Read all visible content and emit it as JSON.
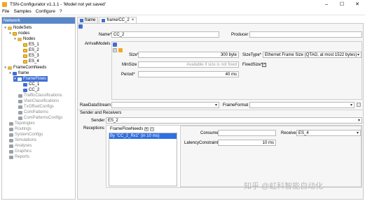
{
  "window": {
    "title": "TSN-Configurator v1.1.1 - 'Model not yet saved'"
  },
  "menu": [
    "File",
    "Samples",
    "Configure",
    "?"
  ],
  "network_panel": {
    "title": "Network",
    "items": [
      {
        "label": "NodeSets",
        "twisty": "▾",
        "icon": "folder"
      },
      {
        "label": "nodes",
        "twisty": "▾",
        "icon": "node"
      },
      {
        "label": "Nodes",
        "twisty": "▾",
        "icon": "folder"
      },
      {
        "label": "ES_1",
        "twisty": "",
        "icon": "node"
      },
      {
        "label": "ES_2",
        "twisty": "",
        "icon": "node"
      },
      {
        "label": "ES_3",
        "twisty": "",
        "icon": "node"
      },
      {
        "label": "ES_4",
        "twisty": "",
        "icon": "node"
      },
      {
        "label": "FrameComNeeds",
        "twisty": "▾",
        "icon": "folder"
      },
      {
        "label": "frame",
        "twisty": "▾",
        "icon": "blue"
      },
      {
        "label": "FrameFlows",
        "twisty": "▾",
        "icon": "blue"
      },
      {
        "label": "CC_1",
        "twisty": "",
        "icon": "blue"
      },
      {
        "label": "CC_2",
        "twisty": "",
        "icon": "blue"
      },
      {
        "label": "TrafficClassifications",
        "twisty": "",
        "icon": "gray"
      },
      {
        "label": "VlanClassifications",
        "twisty": "",
        "icon": "gray"
      },
      {
        "label": "TxOffsetConfigs",
        "twisty": "",
        "icon": "gray"
      },
      {
        "label": "ComPatterns",
        "twisty": "",
        "icon": "gray"
      },
      {
        "label": "ComPatternsConfigs",
        "twisty": "",
        "icon": "gray"
      },
      {
        "label": "Topologies",
        "twisty": "",
        "icon": "gray"
      },
      {
        "label": "Routings",
        "twisty": "",
        "icon": "gray"
      },
      {
        "label": "SystemConfigs",
        "twisty": "",
        "icon": "gray"
      },
      {
        "label": "Simulations",
        "twisty": "",
        "icon": "gray"
      },
      {
        "label": "Analyses",
        "twisty": "",
        "icon": "gray"
      },
      {
        "label": "Graphics",
        "twisty": "",
        "icon": "gray"
      },
      {
        "label": "Reports",
        "twisty": "",
        "icon": "gray"
      }
    ]
  },
  "tabs": [
    {
      "label": "frame",
      "closable": false
    },
    {
      "label": "frame/CC_2",
      "closable": true
    }
  ],
  "form": {
    "name_label": "Name*",
    "name_value": "CC_2",
    "producer_label": "Producer",
    "producer_value": "",
    "arrival_models_label": "ArrivalModels",
    "size_label": "Size*",
    "size_value": "300 byte",
    "size_type_label": "SizeType*",
    "size_type_value": "Ethernet Frame Size (QTAG, at most 1522 bytes)",
    "min_size_label": "MinSize",
    "min_size_placeholder": "Available if size is not fixed",
    "fixed_size_label": "FixedSize*",
    "fixed_size_checked": "✓",
    "period_label": "Period*",
    "period_value": "40 ms",
    "raw_data_stream_label": "RawDataStream",
    "raw_data_stream_value": "",
    "frame_format_label": "FrameFormat",
    "frame_format_value": "",
    "sender_receivers_label": "Sender and Receivers",
    "sender_label": "Sender",
    "sender_value": "ES_2",
    "receptions_label": "Receptions",
    "frame_flow_needs_label": "FrameFlowNeeds",
    "frame_flow_needs_items": [
      "By \"CC_2_Rx1\" (in 10 ms)"
    ],
    "consumer_label": "Consumer",
    "consumer_value": "",
    "receiver_label": "Receiver",
    "receiver_value": "ES_4",
    "latency_label": "LatencyConstraint",
    "latency_value": "10 ms"
  },
  "watermark": "知乎 @虹科智能自动化",
  "colors": {
    "selection": "#3f6fd1",
    "accent_orange": "#f5a623"
  }
}
